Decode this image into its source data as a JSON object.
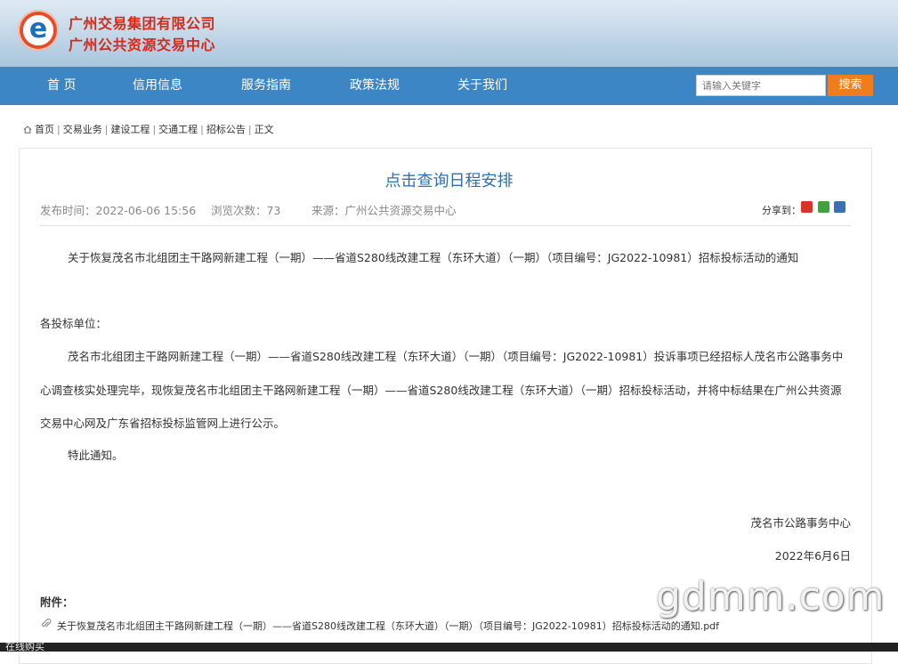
{
  "header": {
    "org_name_1": "广州交易集团有限公司",
    "org_name_2": "广州公共资源交易中心",
    "logo_letter": "e"
  },
  "nav": {
    "items": [
      "首 页",
      "信用信息",
      "服务指南",
      "政策法规",
      "关于我们"
    ],
    "search_placeholder": "请输入关键字",
    "search_button": "搜索"
  },
  "breadcrumb": [
    "首页",
    "交易业务",
    "建设工程",
    "交通工程",
    "招标公告",
    "正文"
  ],
  "article": {
    "title": "点击查询日程安排",
    "publish_time": "发布时间：2022-06-06 15:56",
    "views": "浏览次数：73",
    "source": "来源：广州公共资源交易中心",
    "share_label": "分享到：",
    "notice_title": "关于恢复茂名市北组团主干路网新建工程（一期）——省道S280线改建工程（东环大道）（一期）（项目编号：JG2022-10981）招标投标活动的通知",
    "salutation": "各投标单位：",
    "body": "茂名市北组团主干路网新建工程（一期）——省道S280线改建工程（东环大道）（一期）（项目编号：JG2022-10981）投诉事项已经招标人茂名市公路事务中心调查核实处理完毕，现恢复茂名市北组团主干路网新建工程（一期）——省道S280线改建工程（东环大道）（一期）招标投标活动，并将中标结果在广州公共资源交易中心网及广东省招标投标监管网上进行公示。",
    "closing": "特此通知。",
    "signature": "茂名市公路事务中心",
    "date": "2022年6月6日",
    "attachments_label": "附件：",
    "attachment_file": "关于恢复茂名市北组团主干路网新建工程（一期）——省道S280线改建工程（东环大道）（一期）（项目编号：JG2022-10981）招标投标活动的通知.pdf"
  },
  "watermark": "gdmm.com",
  "bottom_bar_text": "在线购买",
  "colors": {
    "nav": "#3c86c5",
    "title": "#2f6fb1",
    "org": "#d42a1c",
    "search_button": "#ef7d1d"
  }
}
